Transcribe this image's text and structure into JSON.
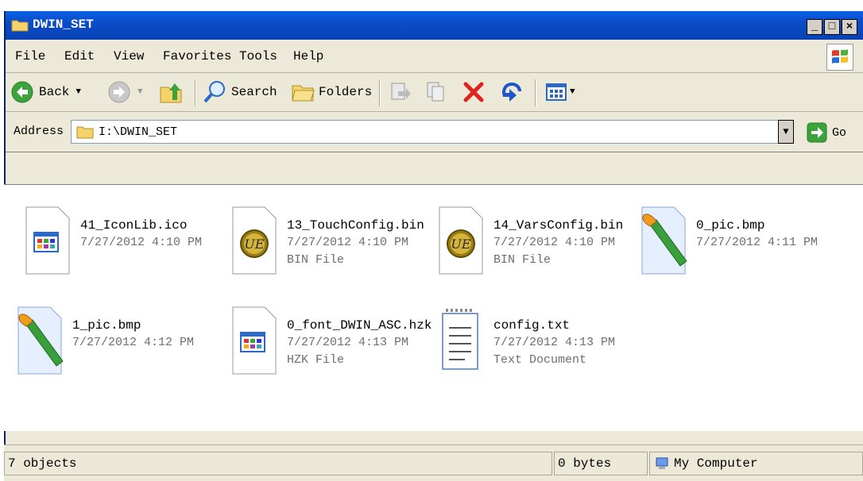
{
  "window": {
    "title": "DWIN_SET"
  },
  "menu": [
    {
      "label": "File",
      "key": "F"
    },
    {
      "label": "Edit",
      "key": "E"
    },
    {
      "label": "View",
      "key": "V"
    },
    {
      "label": "Favorites",
      "key": "a"
    },
    {
      "label": "Tools",
      "key": "T"
    },
    {
      "label": "Help",
      "key": "H"
    }
  ],
  "toolbar": {
    "back_label": "Back",
    "search_label": "Search",
    "folders_label": "Folders"
  },
  "address": {
    "label": "Address",
    "value": "I:\\DWIN_SET",
    "go_label": "Go"
  },
  "files": [
    {
      "name": "41_IconLib.ico",
      "date": "7/27/2012 4:10 PM",
      "type": "",
      "icon": "ico-file-icon"
    },
    {
      "name": "13_TouchConfig.bin",
      "date": "7/27/2012 4:10 PM",
      "type": "BIN File",
      "icon": "ultraedit-file-icon"
    },
    {
      "name": "14_VarsConfig.bin",
      "date": "7/27/2012 4:10 PM",
      "type": "BIN File",
      "icon": "ultraedit-file-icon"
    },
    {
      "name": "0_pic.bmp",
      "date": "7/27/2012 4:11 PM",
      "type": "",
      "icon": "paint-file-icon"
    },
    {
      "name": "1_pic.bmp",
      "date": "7/27/2012 4:12 PM",
      "type": "",
      "icon": "paint-file-icon"
    },
    {
      "name": "0_font_DWIN_ASC.hzk",
      "date": "7/27/2012 4:13 PM",
      "type": "HZK File",
      "icon": "hzk-file-icon"
    },
    {
      "name": "config.txt",
      "date": "7/27/2012 4:13 PM",
      "type": "Text Document",
      "icon": "text-file-icon"
    }
  ],
  "status": {
    "objects": "7 objects",
    "size": "0 bytes",
    "zone": "My Computer"
  }
}
